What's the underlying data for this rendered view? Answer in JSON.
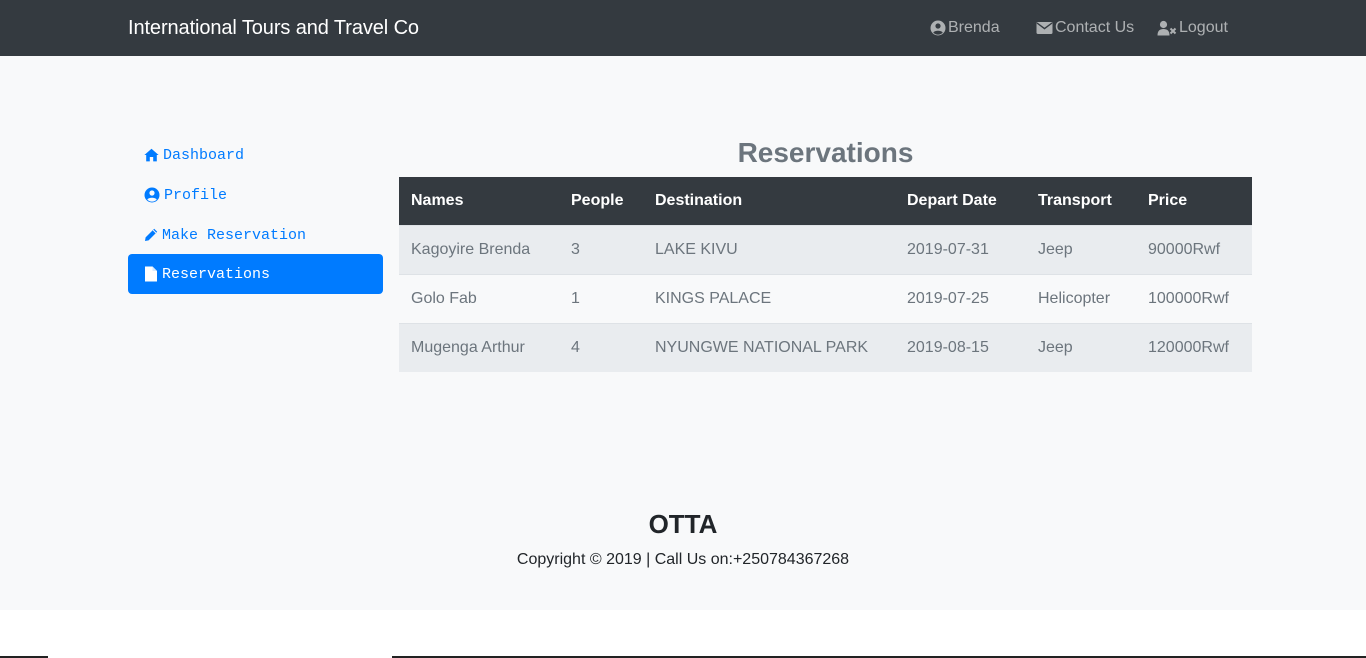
{
  "navbar": {
    "brand": "International Tours and Travel Co",
    "user": {
      "label": "Brenda",
      "icon": "user-circle-icon"
    },
    "contact": {
      "label": "Contact Us",
      "icon": "envelope-icon"
    },
    "logout": {
      "label": "Logout",
      "icon": "user-times-icon"
    }
  },
  "sidebar": {
    "items": [
      {
        "label": "Dashboard",
        "icon": "home-icon",
        "active": false
      },
      {
        "label": "Profile",
        "icon": "user-circle-icon",
        "active": false
      },
      {
        "label": "Make Reservation",
        "icon": "pencil-icon",
        "active": false
      },
      {
        "label": "Reservations",
        "icon": "file-icon",
        "active": true
      }
    ]
  },
  "content": {
    "title": "Reservations",
    "table": {
      "headers": [
        "Names",
        "People",
        "Destination",
        "Depart Date",
        "Transport",
        "Price"
      ],
      "rows": [
        [
          "Kagoyire Brenda",
          "3",
          "LAKE KIVU",
          "2019-07-31",
          "Jeep",
          "90000Rwf"
        ],
        [
          "Golo Fab",
          "1",
          "KINGS PALACE",
          "2019-07-25",
          "Helicopter",
          "100000Rwf"
        ],
        [
          "Mugenga Arthur",
          "4",
          "NYUNGWE NATIONAL PARK",
          "2019-08-15",
          "Jeep",
          "120000Rwf"
        ]
      ]
    }
  },
  "footer": {
    "title": "OTTA",
    "copyright": "Copyright © 2019 | Call Us on:+250784367268"
  },
  "colors": {
    "navbar_bg": "#343a40",
    "primary": "#007bff",
    "muted": "#6c757d",
    "page_bg": "#f8f9fa"
  }
}
